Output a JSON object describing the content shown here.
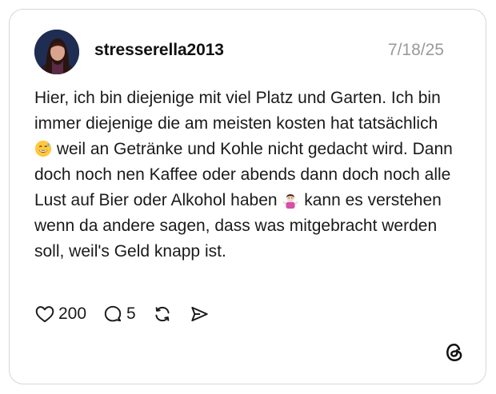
{
  "post": {
    "username": "stresserella2013",
    "timestamp": "7/18/25",
    "text_segments": [
      "Hier, ich bin diejenige mit viel Platz und Garten. Ich bin immer diejenige die am meisten kosten hat tatsächlich ",
      " weil an Getränke und Kohle nicht gedacht wird. Dann doch noch nen Kaffee oder abends dann doch noch alle Lust auf Bier oder Alkohol haben ",
      " kann es verstehen wenn da andere sagen, dass was mitgebracht werden soll, weil's Geld knapp ist."
    ],
    "emojis": [
      "grinning-sweat-emoji",
      "person-shrugging-emoji"
    ]
  },
  "actions": {
    "likes": "200",
    "replies": "5",
    "icons": [
      "heart-icon",
      "comment-icon",
      "repost-icon",
      "share-icon"
    ]
  },
  "branding": {
    "logo": "threads-logo-icon"
  }
}
